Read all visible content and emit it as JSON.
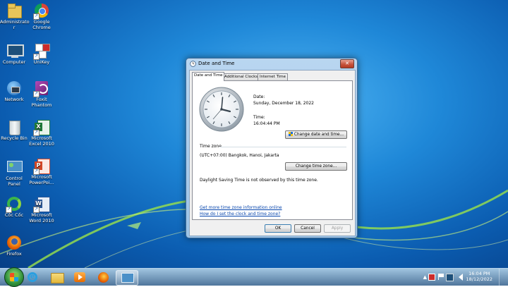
{
  "desktop": {
    "icons": [
      {
        "label": "Administrato r",
        "icon": "user-folder-icon",
        "color": "#e8c55a"
      },
      {
        "label": "Google Chrome",
        "icon": "chrome-icon",
        "color": "#db4437"
      },
      {
        "label": "Computer",
        "icon": "computer-icon",
        "color": "#8fb8d8"
      },
      {
        "label": "UniKey",
        "icon": "unikey-icon",
        "color": "#cc2b2b"
      },
      {
        "label": "Network",
        "icon": "network-icon",
        "color": "#2e7bc4"
      },
      {
        "label": "Foxit Phantom",
        "icon": "foxit-icon",
        "color": "#8a2c8f"
      },
      {
        "label": "Recycle Bin",
        "icon": "recycle-bin-icon",
        "color": "#cfd8dc"
      },
      {
        "label": "Microsoft Excel 2010",
        "icon": "excel-icon",
        "color": "#1f7a3a"
      },
      {
        "label": "Control Panel",
        "icon": "control-panel-icon",
        "color": "#4a90c8"
      },
      {
        "label": "Microsoft PowerPoi...",
        "icon": "powerpoint-icon",
        "color": "#d24726"
      },
      {
        "label": "Cốc Cốc",
        "icon": "coccoc-icon",
        "color": "#3bb54a"
      },
      {
        "label": "Microsoft Word 2010",
        "icon": "word-icon",
        "color": "#2b5797"
      },
      {
        "label": "Firefox",
        "icon": "firefox-icon",
        "color": "#e66000"
      }
    ]
  },
  "window": {
    "title": "Date and Time",
    "close_label": "✕",
    "tabs": [
      {
        "label": "Date and Time",
        "active": true
      },
      {
        "label": "Additional Clocks",
        "active": false
      },
      {
        "label": "Internet Time",
        "active": false
      }
    ],
    "date_label": "Date:",
    "date_value": "Sunday, December 18, 2022",
    "time_label": "Time:",
    "time_value": "16:04:44 PM",
    "change_datetime_button": "Change date and time...",
    "timezone_heading": "Time zone",
    "timezone_value": "(UTC+07:00) Bangkok, Hanoi, Jakarta",
    "change_timezone_button": "Change time zone...",
    "dst_note": "Daylight Saving Time is not observed by this time zone.",
    "link_timezone_info": "Get more time zone information online",
    "link_how_to": "How do I set the clock and time zone?",
    "ok_button": "OK",
    "cancel_button": "Cancel",
    "apply_button": "Apply"
  },
  "taskbar": {
    "apps": [
      {
        "name": "internet-explorer",
        "icon": "ie-icon",
        "active": false
      },
      {
        "name": "file-explorer",
        "icon": "folder-icon",
        "active": false
      },
      {
        "name": "media-player",
        "icon": "media-player-icon",
        "active": false
      },
      {
        "name": "firefox",
        "icon": "firefox-icon",
        "active": false
      },
      {
        "name": "date-and-time",
        "icon": "control-panel-icon",
        "active": true
      }
    ],
    "clock_time": "16:04 PM",
    "clock_date": "18/12/2022"
  }
}
